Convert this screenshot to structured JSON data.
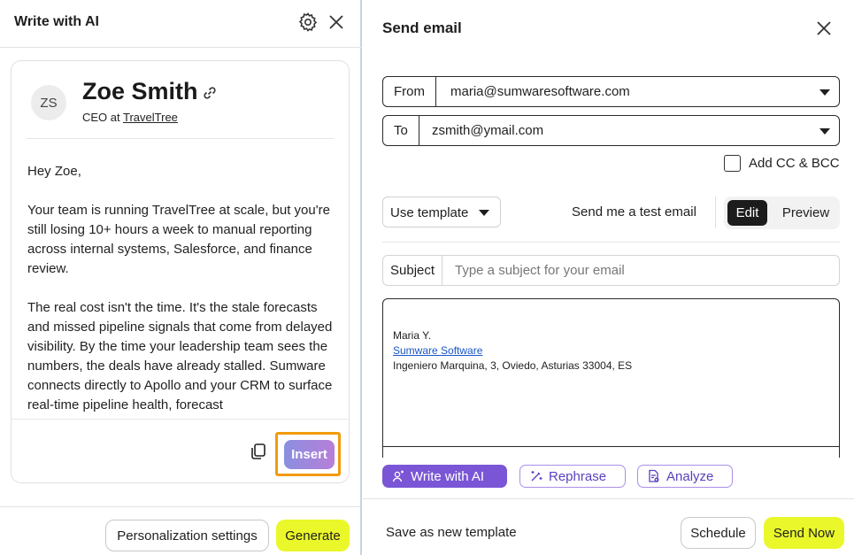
{
  "left_panel": {
    "title": "Write with AI",
    "settings_icon": "gear-icon",
    "close_icon": "close-icon",
    "contact": {
      "initials": "ZS",
      "name": "Zoe Smith",
      "role_prefix": "CEO at",
      "company": "TravelTree",
      "link_icon": "link-icon"
    },
    "email_paragraphs": [
      "Hey Zoe,",
      "Your team is running TravelTree at scale, but you're still losing 10+ hours a week to manual reporting across internal systems, Salesforce, and finance review.",
      "The real cost isn't the time. It's the stale forecasts and missed pipeline signals that come from delayed visibility. By the time your leadership team sees the numbers, the deals have already stalled. Sumware connects directly to Apollo and your CRM to surface real-time pipeline health, forecast"
    ],
    "copy_icon": "copy-icon",
    "insert_label": "Insert",
    "personalization_label": "Personalization settings",
    "generate_label": "Generate"
  },
  "right_panel": {
    "title": "Send email",
    "close_icon": "close-icon",
    "from": {
      "label": "From",
      "value": "maria@sumwaresoftware.com"
    },
    "to": {
      "label": "To",
      "value": "zsmith@ymail.com"
    },
    "cc_bcc_label": "Add CC & BCC",
    "template_label": "Use template",
    "test_email_label": "Send me a test email",
    "edit_label": "Edit",
    "preview_label": "Preview",
    "subject_label": "Subject",
    "subject_placeholder": "Type a subject for your email",
    "signature": {
      "name": "Maria Y.",
      "company": "Sumware Software",
      "address": "Ingeniero Marquina, 3, Oviedo, Asturias 33004, ES"
    },
    "ai_actions": {
      "write": "Write with AI",
      "rephrase": "Rephrase",
      "analyze": "Analyze"
    },
    "save_template_label": "Save as new template",
    "schedule_label": "Schedule",
    "send_now_label": "Send Now"
  },
  "colors": {
    "accent_yellow": "#eaf72a",
    "ai_purple": "#7a56d6",
    "highlight_orange": "#f29b0c"
  }
}
